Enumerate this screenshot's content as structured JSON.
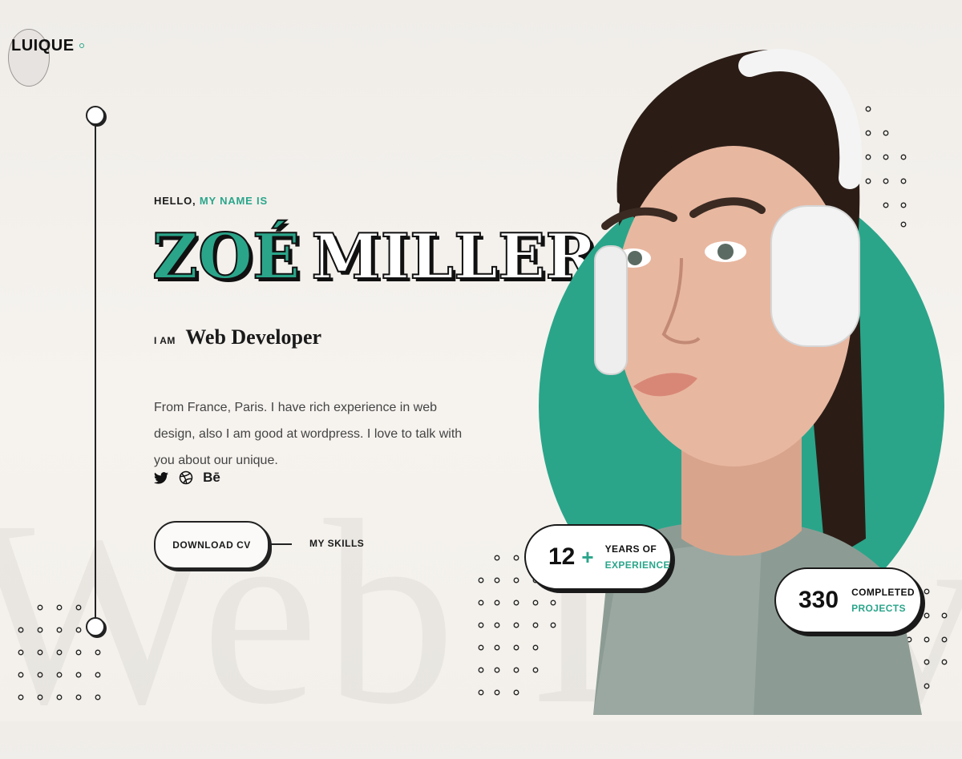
{
  "logo": {
    "text": "LUIQUE"
  },
  "hero": {
    "greeting": "HELLO,",
    "greeting_accent": "MY NAME IS",
    "first_name": "ZOÉ",
    "last_name": "MILLER",
    "iam_label": "I AM",
    "role": "Web Developer",
    "description": "From France, Paris. I have rich experience in web design, also I am good at wordpress. I love to talk with you about our unique.",
    "background_word": "Web Developer"
  },
  "social": [
    {
      "name": "twitter-icon"
    },
    {
      "name": "dribbble-icon"
    },
    {
      "name": "behance-icon",
      "text": "Bē"
    }
  ],
  "actions": {
    "download_cv": "DOWNLOAD CV",
    "my_skills": "MY SKILLS"
  },
  "stats": {
    "experience": {
      "value": "12",
      "plus": "+",
      "label_line1": "YEARS OF",
      "label_line2": "EXPERIENCE"
    },
    "projects": {
      "value": "330",
      "label_line1": "COMPLETED",
      "label_line2": "PROJECTS"
    }
  },
  "colors": {
    "accent": "#2aa58a",
    "ink": "#1a1a1a",
    "background": "#f3f0eb"
  }
}
